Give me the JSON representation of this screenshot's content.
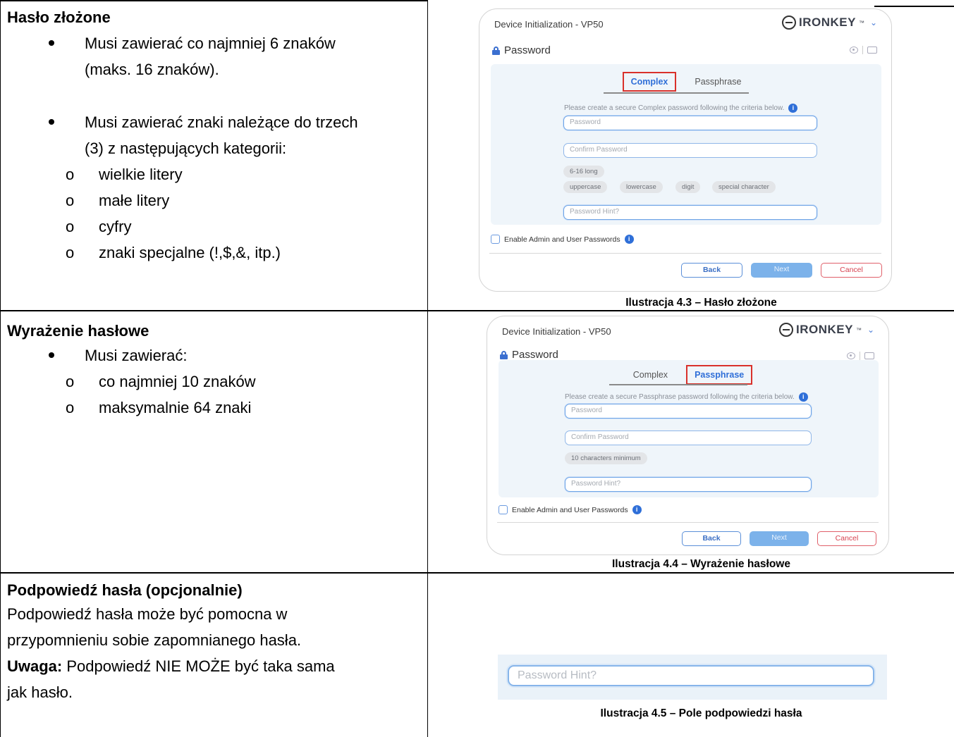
{
  "section_complex": {
    "heading": "Hasło złożone",
    "bullet1_line1": "Musi zawierać co najmniej 6 znaków",
    "bullet1_line2": "(maks. 16 znaków).",
    "bullet2_line1": "Musi zawierać znaki należące do trzech",
    "bullet2_line2": "(3) z następujących kategorii:",
    "categories": [
      "wielkie litery",
      "małe litery",
      "cyfry",
      "znaki specjalne (!,$,&, itp.)"
    ],
    "sub_marker": "o",
    "caption": "Ilustracja 4.3 – Hasło złożone"
  },
  "section_passphrase": {
    "heading": "Wyrażenie hasłowe",
    "bullet1": "Musi zawierać:",
    "items": [
      "co najmniej 10 znaków",
      "maksymalnie 64 znaki"
    ],
    "sub_marker": "o",
    "caption": "Ilustracja 4.4 – Wyrażenie hasłowe"
  },
  "section_hint": {
    "heading": "Podpowiedź hasła (opcjonalnie)",
    "line1": "Podpowiedź hasła może być pomocna w",
    "line2": "przypomnieniu sobie zapomnianego hasła.",
    "note_label": "Uwaga:",
    "line3_rest": " Podpowiedź NIE MOŻE być taka sama",
    "line4": "jak hasło.",
    "caption": "Ilustracja 4.5 – Pole podpowiedzi hasła",
    "field_placeholder": "Password Hint?"
  },
  "dialog": {
    "title": "Device Initialization - VP50",
    "brand": "IRONKEY",
    "brand_tm": "™",
    "chevron": "⌄",
    "section_label": "Password",
    "tab_complex": "Complex",
    "tab_passphrase": "Passphrase",
    "instr_complex": "Please create a secure Complex password following the criteria below.",
    "instr_passphrase": "Please create a secure Passphrase password following the criteria below.",
    "info_glyph": "i",
    "password_placeholder": "Password",
    "confirm_placeholder": "Confirm Password",
    "hint_placeholder": "Password Hint?",
    "chip_length": "6-16 long",
    "chips_categories": [
      "uppercase",
      "lowercase",
      "digit",
      "special character"
    ],
    "chip_min": "10 characters minimum",
    "enable_label": "Enable Admin and User Passwords",
    "back": "Back",
    "next": "Next",
    "cancel": "Cancel"
  }
}
